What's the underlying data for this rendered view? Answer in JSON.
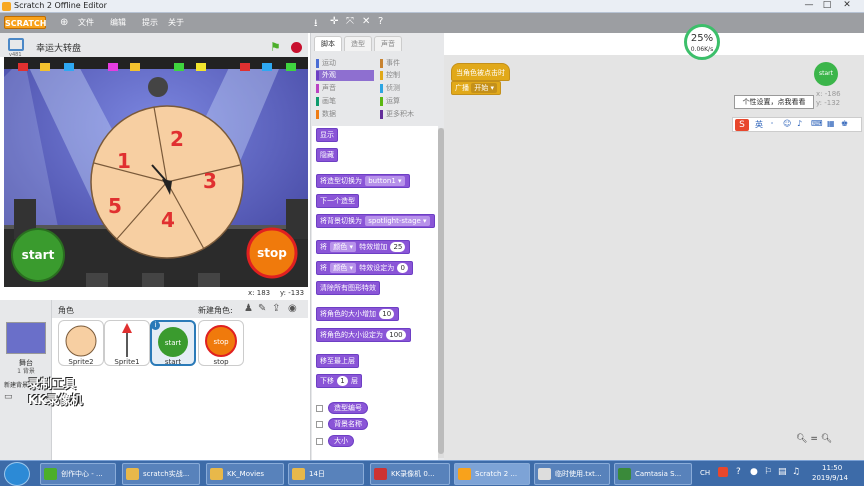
{
  "window": {
    "title": "Scratch 2 Offline Editor",
    "minimize": "—",
    "maximize": "□",
    "close": "✕"
  },
  "menu": {
    "logo": "SCRATCH",
    "file": "文件",
    "edit": "编辑",
    "tips": "提示",
    "about": "关于"
  },
  "toolbar_icons": [
    "stamp-icon",
    "grow-icon",
    "shrink-icon",
    "help-icon"
  ],
  "stage": {
    "project_title": "幸运大转盘",
    "version_tag": "v481",
    "wheel_numbers": [
      "2",
      "3",
      "4",
      "5",
      "1"
    ],
    "start_label": "start",
    "stop_label": "stop",
    "x_label": "x:",
    "x_value": "183",
    "y_label": "y:",
    "y_value": "-133"
  },
  "stage_panel": {
    "label": "舞台",
    "backdrops": "1 背景",
    "new_backdrop": "新建背景:"
  },
  "sprites_panel": {
    "header": "角色",
    "new_sprite": "新建角色:",
    "sprites": [
      {
        "name": "Sprite2"
      },
      {
        "name": "Sprite1"
      },
      {
        "name": "start"
      },
      {
        "name": "stop"
      }
    ]
  },
  "tabs": {
    "scripts": "脚本",
    "costumes": "造型",
    "sounds": "声音"
  },
  "categories": {
    "left": [
      {
        "label": "运动",
        "color": "#4a6cd4"
      },
      {
        "label": "外观",
        "color": "#8a55d7"
      },
      {
        "label": "声音",
        "color": "#bb42c3"
      },
      {
        "label": "画笔",
        "color": "#0e9a6c"
      },
      {
        "label": "数据",
        "color": "#ee7d16"
      }
    ],
    "right": [
      {
        "label": "事件",
        "color": "#c88330"
      },
      {
        "label": "控制",
        "color": "#e1a91a"
      },
      {
        "label": "侦测",
        "color": "#2ca5e2"
      },
      {
        "label": "运算",
        "color": "#5cb712"
      },
      {
        "label": "更多积木",
        "color": "#632d99"
      }
    ],
    "selected": "外观"
  },
  "blocks": {
    "show": "显示",
    "hide": "隐藏",
    "switch_costume": "将造型切换为",
    "costume_value": "button1",
    "next_costume": "下一个造型",
    "switch_backdrop": "将背景切换为",
    "backdrop_value": "spotlight-stage",
    "change_effect_prefix": "将",
    "effect_name": "颜色",
    "change_effect_mid": "特效增加",
    "change_effect_value": "25",
    "set_effect_mid": "特效设定为",
    "set_effect_value": "0",
    "clear_effects": "清除所有图形特效",
    "change_size": "将角色的大小增加",
    "change_size_value": "10",
    "set_size": "将角色的大小设定为",
    "set_size_value": "100",
    "go_front": "移至最上层",
    "go_back_prefix": "下移",
    "go_back_value": "1",
    "go_back_suffix": "层",
    "costume_number": "造型编号",
    "backdrop_name": "背景名称",
    "size": "大小"
  },
  "script": {
    "hat": "当角色被点击时",
    "broadcast": "广播",
    "message": "开始"
  },
  "overlay": {
    "net_percent": "25%",
    "net_speed": "0.06K/s",
    "sprite_thumb": "start",
    "xy_x": "x: -186",
    "xy_y": "y: -132",
    "tooltip": "个性设置，点我看看",
    "ime_label": "英",
    "watermark_line1": "录制工具",
    "watermark_line2": "KK录像机"
  },
  "taskbar": {
    "items": [
      "创作中心 - ...",
      "scratch实战...",
      "KK_Movies",
      "14日",
      "KK录像机 0...",
      "Scratch 2 ...",
      "临时使用.txt...",
      "Camtasia S..."
    ],
    "lang": "CH",
    "time": "11:50",
    "date": "2019/9/14"
  }
}
